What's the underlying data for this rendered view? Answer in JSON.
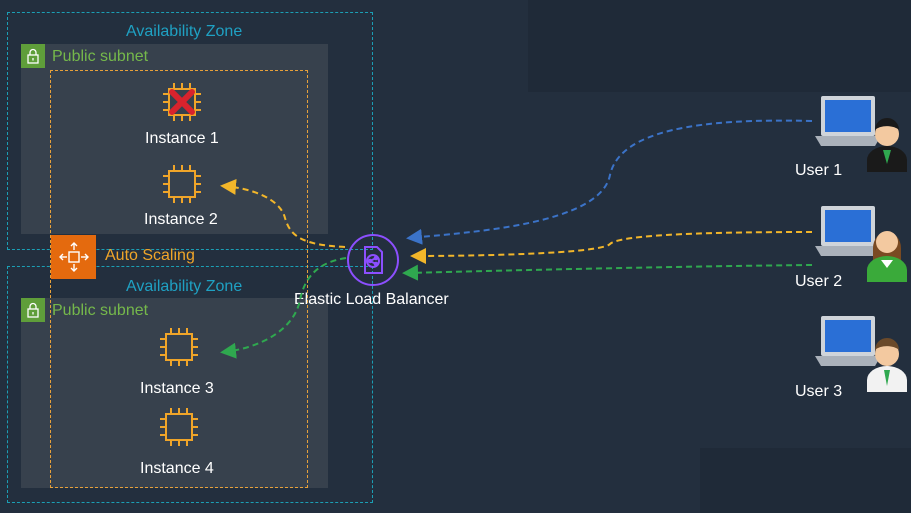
{
  "availability_zones": [
    {
      "label": "Availability Zone",
      "subnet_label": "Public subnet",
      "instances": [
        {
          "label": "Instance 1",
          "status": "failed"
        },
        {
          "label": "Instance 2",
          "status": "healthy"
        }
      ]
    },
    {
      "label": "Availability Zone",
      "subnet_label": "Public subnet",
      "instances": [
        {
          "label": "Instance 3",
          "status": "healthy"
        },
        {
          "label": "Instance 4",
          "status": "healthy"
        }
      ]
    }
  ],
  "auto_scaling": {
    "label": "Auto Scaling"
  },
  "load_balancer": {
    "label": "Elastic Load Balancer"
  },
  "users": [
    {
      "label": "User 1"
    },
    {
      "label": "User 2"
    },
    {
      "label": "User 3"
    }
  ],
  "colors": {
    "background": "#232f3e",
    "zone_border": "#1b9fb5",
    "subnet_fill": "#37414d",
    "subnet_green": "#5f9e3a",
    "asg_orange": "#e46a0e",
    "instance_orange": "#f0a529",
    "elb_purple": "#8c4fff",
    "flow_blue": "#3b73c8",
    "flow_yellow": "#f2b62a",
    "flow_green": "#2fa84f",
    "failed_red": "#d9232d"
  }
}
